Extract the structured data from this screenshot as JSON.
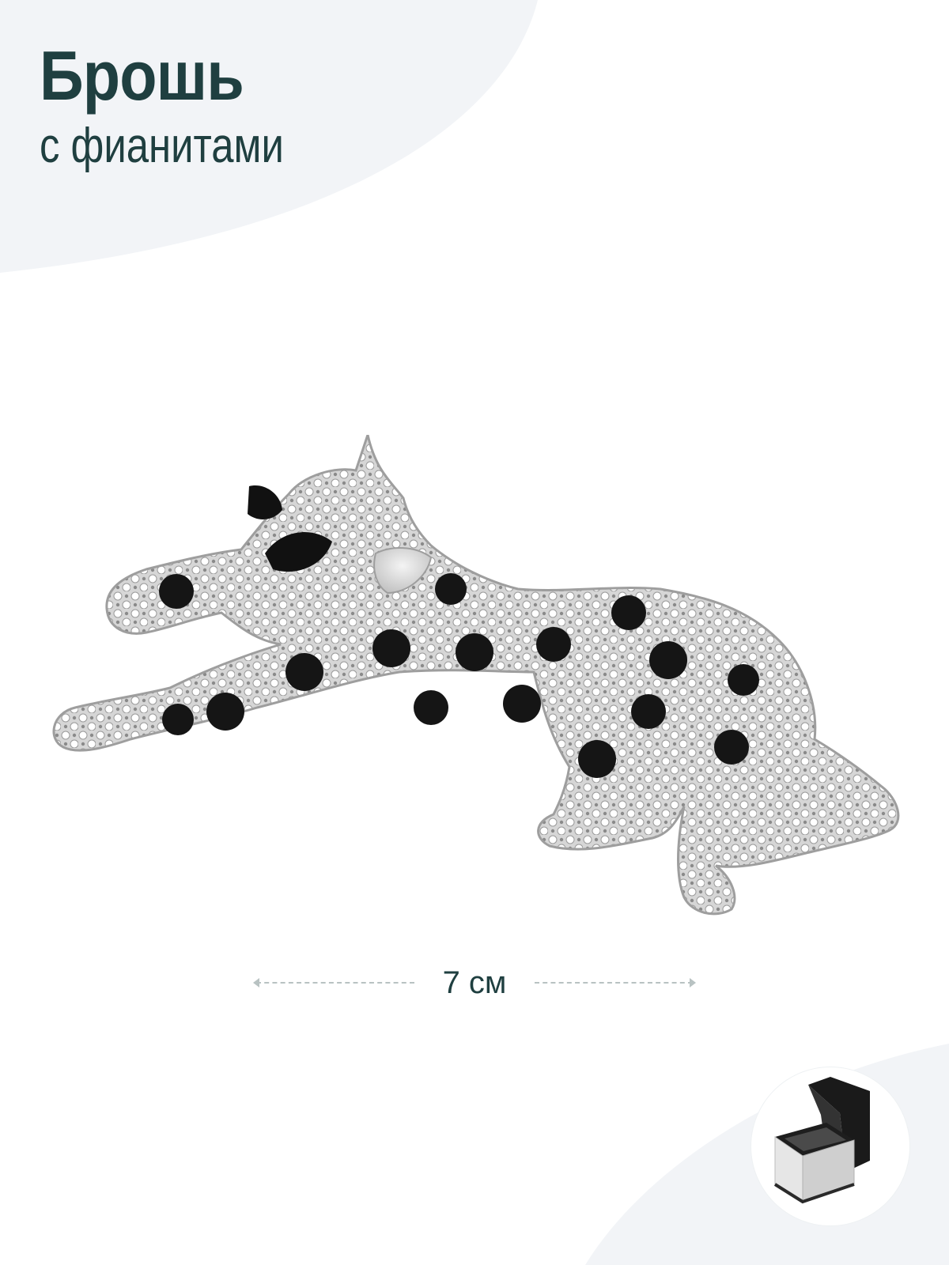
{
  "header": {
    "title": "Брошь",
    "subtitle": "с фианитами"
  },
  "dimension": {
    "label": "7 см"
  },
  "icons": {
    "product": "leopard-brooch-image",
    "packaging": "gift-box-icon"
  },
  "colors": {
    "text": "#1f3f40",
    "background_shape": "#f2f4f7",
    "dimension_line": "#b8c2c2"
  }
}
